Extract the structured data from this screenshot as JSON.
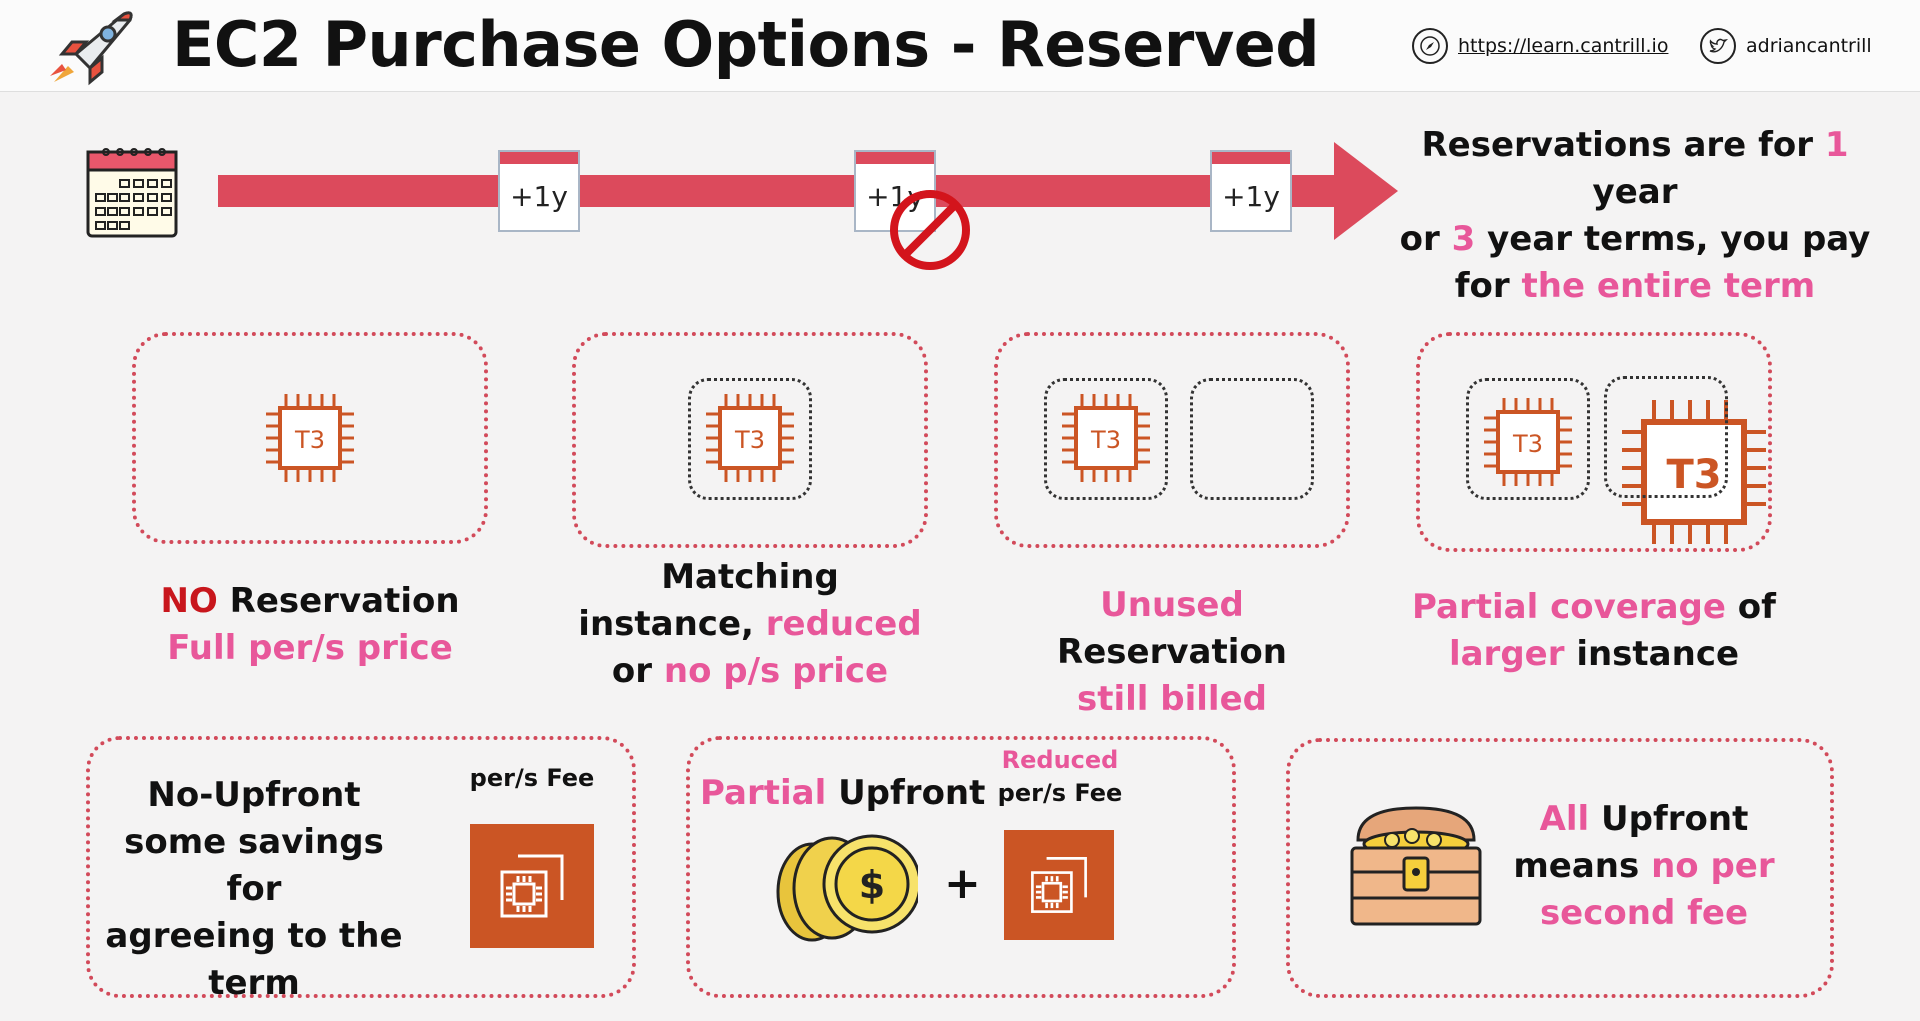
{
  "header": {
    "title": "EC2 Purchase Options - Reserved",
    "website": "https://learn.cantrill.io",
    "twitter": "adriancantrill"
  },
  "timeline": {
    "step_label": "+1y",
    "description": {
      "t1": "Reservations are for ",
      "t2": "1",
      "t3": " year",
      "t4": "or ",
      "t5": "3",
      "t6": " year terms, you pay",
      "t7": "for ",
      "t8": "the entire term"
    }
  },
  "scenarios": {
    "chip_label": "T3",
    "no_reservation": {
      "a": "NO",
      "b": " Reservation",
      "c": "Full per/s price"
    },
    "matching": {
      "a": "Matching",
      "b": "instance, ",
      "c": "reduced",
      "d": "or ",
      "e": "no p/s price"
    },
    "unused": {
      "a": "Unused",
      "b": " Reservation",
      "c": "still billed"
    },
    "partial": {
      "a": "Partial coverage",
      "b": " of",
      "c": "larger",
      "d": " instance"
    }
  },
  "payment": {
    "no_upfront": {
      "l1": "No-Upfront",
      "l2": "some savings for",
      "l3": "agreeing to the",
      "l4": "term",
      "fee": "per/s Fee"
    },
    "partial_upfront": {
      "a": "Partial",
      "b": " Upfront",
      "fee_top": "Reduced",
      "fee": "per/s Fee",
      "plus": "+",
      "coin_symbol": "$"
    },
    "all_upfront": {
      "a": "All",
      "b": " Upfront",
      "c": "means ",
      "d": "no per",
      "e": "second fee"
    }
  },
  "colors": {
    "accent_pink": "#e8579a",
    "timeline_red": "#dc4a5c",
    "chip_orange": "#cb5524",
    "no_red": "#c8161c"
  }
}
